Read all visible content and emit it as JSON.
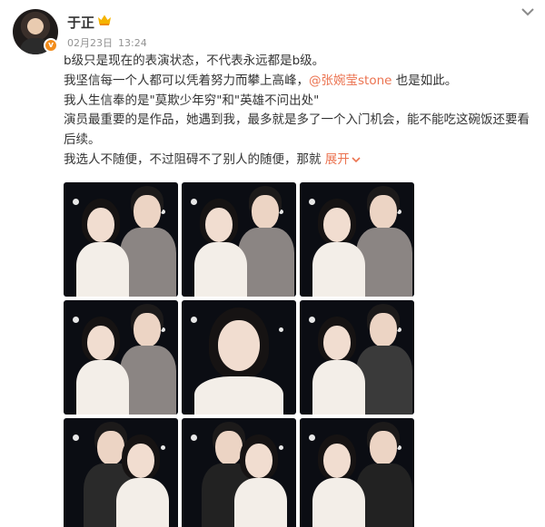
{
  "post": {
    "author": "于正",
    "date": "02月23日",
    "time": "13:24",
    "lines": [
      "b级只是现在的表演状态，不代表永远都是b级。",
      "我坚信每一个人都可以凭着努力而攀上高峰，",
      "我人生信奉的是\"莫欺少年穷\"和\"英雄不问出处\"",
      "演员最重要的是作品，她遇到我，最多就是多了一个入门机会，能不能吃这碗饭还要看",
      "后续。",
      "我选人不随便，不过阻碍不了别人的随便，那就 "
    ],
    "mention": "@张婉莹stone",
    "mention_suffix": " 也是如此。",
    "expand_label": "展开",
    "accent_color": "#eb7350",
    "verified_color": "#f28c1b"
  },
  "icons": {
    "avatar": "avatar",
    "verified": "verified-badge-icon",
    "crown": "crown-icon",
    "menu": "chevron-down-icon"
  },
  "photos": [
    {
      "jacket": "#8b8583"
    },
    {
      "jacket": "#8b8583"
    },
    {
      "jacket": "#8b8583"
    },
    {
      "jacket": "#8b8583"
    },
    {
      "jacket": "none"
    },
    {
      "jacket": "#3a3a3a"
    },
    {
      "jacket": "#2a2a2a"
    },
    {
      "jacket": "#222222"
    },
    {
      "jacket": "#222222"
    }
  ]
}
